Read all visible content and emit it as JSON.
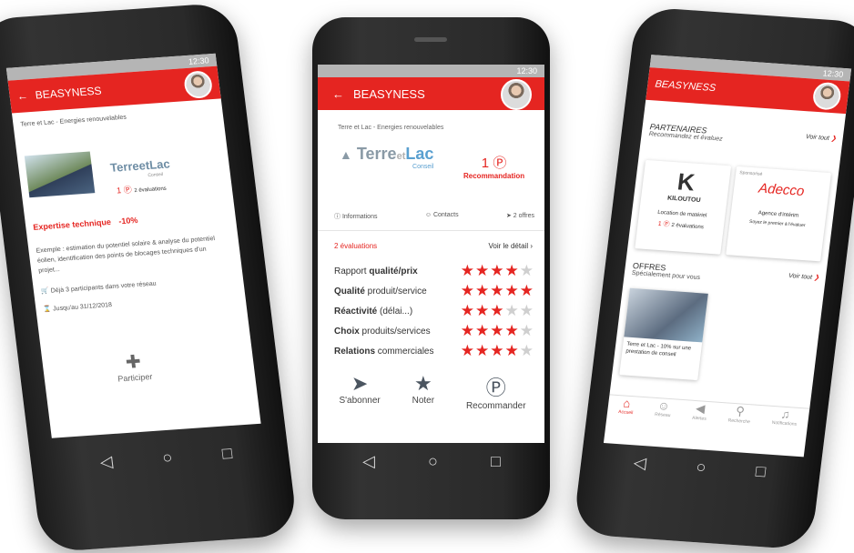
{
  "brand": "BEASYNESS",
  "time": "12:30",
  "center": {
    "subtitle": "Terre et Lac - Energies renouvelables",
    "logo_main": "Terre",
    "logo_et": "et",
    "logo_lac": "Lac",
    "logo_conseil": "Conseil",
    "reco_count": "1",
    "reco_label": "Recommandation",
    "tabs": [
      "Informations",
      "Contacts",
      "2 offres"
    ],
    "evaluations": "2 évaluations",
    "voir_detail": "Voir le détail",
    "ratings": [
      {
        "bold": "Rapport qualité/prix",
        "label_a": "Rapport ",
        "label_b": "qualité/prix",
        "stars": 4
      },
      {
        "label_a": "Qualité",
        "label_b": " produit/service",
        "stars": 5
      },
      {
        "label_a": "Réactivité",
        "label_b": " (délai...)",
        "stars": 3
      },
      {
        "label_a": "Choix",
        "label_b": " produits/services",
        "stars": 4
      },
      {
        "label_a": "Relations",
        "label_b": " commerciales",
        "stars": 4
      }
    ],
    "actions": [
      "S'abonner",
      "Noter",
      "Recommander"
    ]
  },
  "left": {
    "subtitle": "Terre et Lac - Energies renouvelables",
    "logo": "TerreetLac",
    "logo_conseil": "Conseil",
    "count": "1",
    "eval": "2 évaluations",
    "expertise": "Expertise technique",
    "discount": "-10%",
    "description": "Exemple : estimation du potentiel solaire & analyse du potentiel éolien, identification des points de blocages techniques d'un projet...",
    "participants": "Déjà 3 participants dans votre réseau",
    "until": "Jusqu'au 31/12/2018",
    "participer": "Participer"
  },
  "right": {
    "partenaires": "PARTENAIRES",
    "partenaires_sub": "Recommandez et évaluez",
    "voir_tout": "Voir tout",
    "kiloutou": "KILOUTOU",
    "kiloutou_desc": "Location de matériel",
    "kiloutou_count": "1",
    "kiloutou_eval": "2 évaluations",
    "sponsored": "Sponsorisé",
    "adecco": "Adecco",
    "adecco_desc": "Agence d'intérim",
    "adecco_eval": "Soyez le premier à l'évaluer",
    "offres": "OFFRES",
    "offres_sub": "Spécialement pour vous",
    "offer_text": "Terre et Lac - 10% sur une prestation de conseil",
    "nav": [
      "Accueil",
      "Réseau",
      "Alertes",
      "Recherche",
      "Notifications"
    ]
  },
  "colors": {
    "accent": "#e52521",
    "status": "#b5b5b5"
  }
}
